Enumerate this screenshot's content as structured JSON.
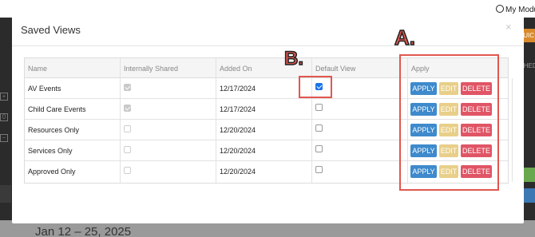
{
  "background": {
    "module_label": "My Modu",
    "orange_tab": "QUIC",
    "sched_label": "CHED",
    "left_icons": [
      "+",
      "0",
      "−"
    ],
    "date_range": "Jan 12 – 25, 2025"
  },
  "modal": {
    "title": "Saved Views",
    "close_glyph": "×"
  },
  "table": {
    "headers": {
      "name": "Name",
      "internally_shared": "Internally Shared",
      "added_on": "Added On",
      "default_view": "Default View",
      "apply": "Apply"
    },
    "rows": [
      {
        "name": "AV Events",
        "internally_shared": true,
        "added_on": "12/17/2024",
        "default_view": true
      },
      {
        "name": "Child Care Events",
        "internally_shared": true,
        "added_on": "12/17/2024",
        "default_view": false
      },
      {
        "name": "Resources Only",
        "internally_shared": false,
        "added_on": "12/20/2024",
        "default_view": false
      },
      {
        "name": "Services Only",
        "internally_shared": false,
        "added_on": "12/20/2024",
        "default_view": false
      },
      {
        "name": "Approved Only",
        "internally_shared": false,
        "added_on": "12/20/2024",
        "default_view": false
      }
    ],
    "actions": {
      "apply_label": "APPLY",
      "edit_label": "EDIT",
      "delete_label": "DELETE"
    }
  },
  "annotations": {
    "label_a": "A.",
    "label_b": "B."
  },
  "colors": {
    "apply": "#3e8acc",
    "edit": "#e8cf8a",
    "delete": "#e05565",
    "annotation": "#e0574f"
  }
}
